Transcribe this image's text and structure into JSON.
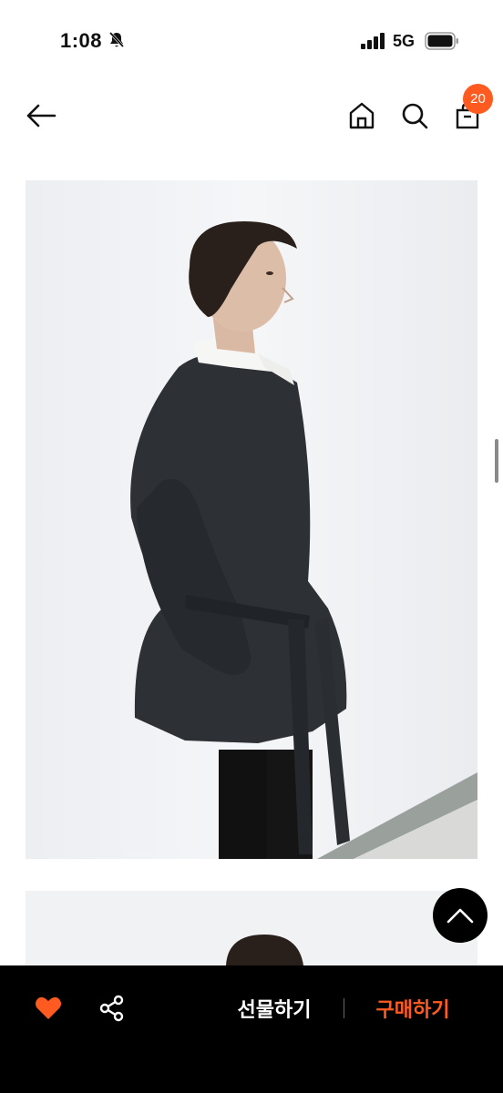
{
  "status_bar": {
    "time": "1:08",
    "network": "5G",
    "icons": [
      "bell-slash-icon",
      "signal-icon",
      "battery-icon"
    ]
  },
  "nav_bar": {
    "icons": [
      "back-arrow-icon",
      "home-icon",
      "search-icon",
      "shopping-bag-icon"
    ],
    "cart_count": "20"
  },
  "product_images": [
    {
      "description_icon": "product-photo",
      "subject": "model wearing dark belted jacket, side profile"
    },
    {
      "description_icon": "product-photo"
    }
  ],
  "bottom_bar": {
    "gift_label": "선물하기",
    "buy_label": "구매하기",
    "icons": [
      "heart-icon",
      "share-icon"
    ]
  },
  "colors": {
    "accent": "#ff5a1f",
    "bottom_bar_bg": "#000000",
    "heart": "#ff5a1f"
  }
}
